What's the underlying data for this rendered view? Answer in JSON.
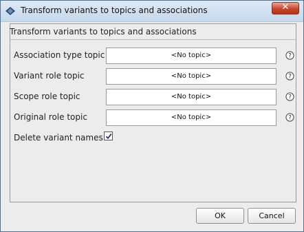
{
  "window": {
    "title": "Transform variants to topics and associations",
    "app_icon": "diamond-icon",
    "close_icon": "close-icon"
  },
  "panel": {
    "title": "Transform variants to topics and associations"
  },
  "rows": [
    {
      "label": "Association type topic",
      "value": "<No topic>"
    },
    {
      "label": "Variant role topic",
      "value": "<No topic>"
    },
    {
      "label": "Scope role topic",
      "value": "<No topic>"
    },
    {
      "label": "Original role topic",
      "value": "<No topic>"
    }
  ],
  "delete_variants": {
    "label": "Delete variant names",
    "checked": true
  },
  "buttons": {
    "ok": "OK",
    "cancel": "Cancel"
  },
  "colors": {
    "title_gradient_top": "#dde9f6",
    "title_gradient_bottom": "#c6d8ec",
    "close_red": "#c7442d",
    "panel_bg": "#ececec"
  }
}
